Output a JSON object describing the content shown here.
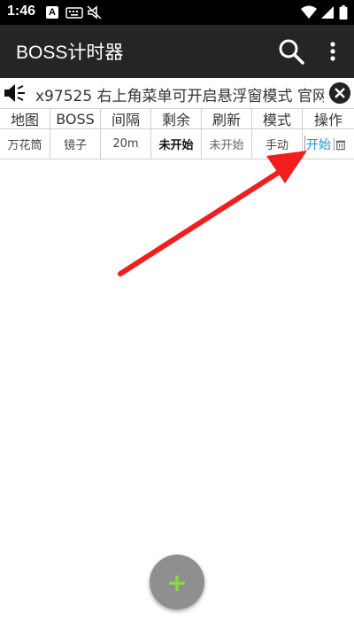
{
  "status_bar": {
    "time": "1:46",
    "a_badge": "A",
    "icons": [
      "a-notification-icon",
      "keyboard-icon",
      "sound-muted-icon",
      "wifi-icon",
      "signal-icon",
      "battery-icon"
    ]
  },
  "app_bar": {
    "title": "BOSS计时器",
    "icons": [
      "search-icon",
      "more-vert-icon"
    ],
    "background": "#252525"
  },
  "notice": {
    "text": "x97525 右上角菜单可开启悬浮窗模式 官网",
    "icons": [
      "speaker-icon",
      "close-icon"
    ]
  },
  "table": {
    "headers": [
      "地图",
      "BOSS",
      "间隔",
      "剩余",
      "刷新",
      "模式",
      "操作"
    ],
    "rows": [
      {
        "map": "万花筒",
        "boss": "镜子",
        "interval": "20m",
        "remaining": "未开始",
        "refresh": "未开始",
        "mode": "手动",
        "start_label": "开始",
        "delete_icon": "trash-icon"
      }
    ]
  },
  "fab": {
    "label": "+",
    "icon": "add-icon",
    "background": "#8f8f8f",
    "plus_color": "#8bd84a"
  },
  "annotation": {
    "icon": "red-arrow-icon",
    "color": "#f21d1d"
  },
  "colors": {
    "link": "#1e90e6",
    "grid": "#cfcfcf"
  }
}
